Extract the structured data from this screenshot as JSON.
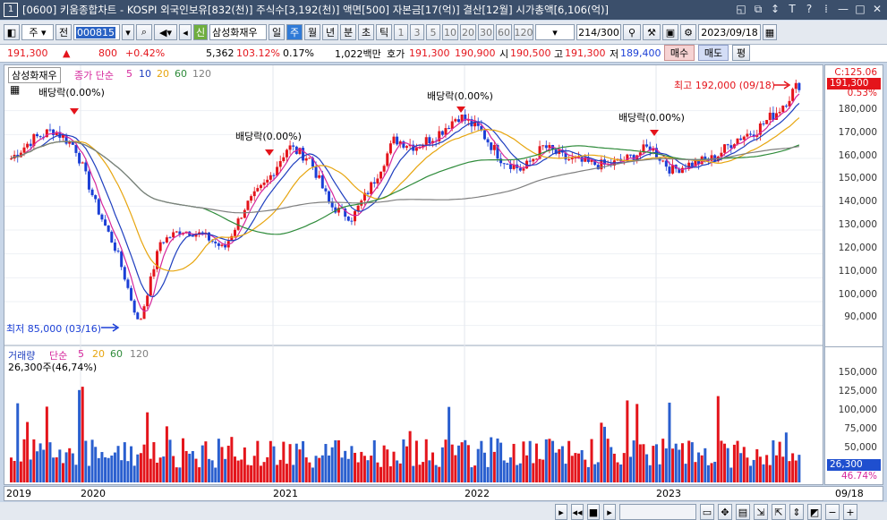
{
  "window": {
    "number": "1",
    "title": "[0600] 키움종합차트 - KOSPI 외국인보유[832(천)] 주식수[3,192(천)] 액면[500] 자본금[17(억)] 결산[12월] 시가총액[6,106(억)]",
    "buttons": [
      "◱",
      "⧉",
      "↕",
      "T",
      "?",
      "⁞",
      "—",
      "□",
      "✕"
    ]
  },
  "toolbar": {
    "period_type": "주",
    "scope": "전",
    "stock_code": "000815",
    "stock_name": "삼성화재우",
    "stock_badge": "신",
    "period_tabs": [
      "일",
      "주",
      "월",
      "년",
      "분",
      "초",
      "틱"
    ],
    "selected_period": "주",
    "intervals": [
      "1",
      "3",
      "5",
      "10",
      "20",
      "30",
      "60",
      "120"
    ],
    "count": "214",
    "count_total": "/300",
    "date": "2023/09/18"
  },
  "quote": {
    "price": "191,300",
    "arrow": "▲",
    "change": "800",
    "change_pct": "+0.42%",
    "volume": "5,362",
    "ratio": "103.12%",
    "rate": "0.17%",
    "amount": "1,022백만",
    "bid_label": "호가",
    "bid": "191,300",
    "ask": "190,900",
    "open_label": "시",
    "open": "190,500",
    "high_label": "고",
    "high": "191,300",
    "low_label": "저",
    "low": "189,400",
    "buy": "매수",
    "sell": "매도",
    "eval": "평"
  },
  "price_panel": {
    "name": "삼성화재우",
    "ma_label": "종가 단순",
    "ma_periods": [
      "5",
      "10",
      "20",
      "60",
      "120"
    ],
    "ma_colors": [
      "#d6279c",
      "#1f3fbf",
      "#e7a50e",
      "#2e8b3a",
      "#7f7f7f"
    ],
    "annotations": [
      "배당락(0.00%)",
      "배당락(0.00%)",
      "배당락(0.00%)",
      "배당락(0.00%)"
    ],
    "highest": "최고 192,000 (09/18)",
    "lowest": "최저 85,000 (03/16)"
  },
  "price_axis": {
    "top_label": "C:125.06",
    "current": "191,300",
    "pct": "0.53%",
    "ticks": [
      "180,000",
      "170,000",
      "160,000",
      "150,000",
      "140,000",
      "130,000",
      "120,000",
      "110,000",
      "100,000",
      "90,000"
    ]
  },
  "volume_panel": {
    "name": "거래량",
    "ma_label": "단순",
    "ma_periods": [
      "5",
      "20",
      "60",
      "120"
    ],
    "current": "26,300주(46,74%)",
    "current_tag": "26,300",
    "pct_tag": "46.74%",
    "ticks": [
      "150,000",
      "125,000",
      "100,000",
      "75,000",
      "50,000"
    ]
  },
  "x_axis": {
    "labels": [
      "2019",
      "2020",
      "2021",
      "2022",
      "2023"
    ],
    "end_label": "09/18"
  },
  "chart_data": {
    "type": "candlestick",
    "title": "삼성화재우 주봉",
    "ylim": [
      82000,
      196000
    ],
    "volume_ylim": [
      0,
      180000
    ],
    "x": [
      "2019-W01",
      "2020-W01",
      "2021-W01",
      "2022-W01",
      "2023-W01",
      "2023-W38"
    ],
    "close_path": [
      160000,
      168000,
      172000,
      165000,
      140000,
      120000,
      90000,
      125000,
      130000,
      128000,
      122000,
      140000,
      150000,
      165000,
      160000,
      140000,
      135000,
      150000,
      168000,
      165000,
      170000,
      178000,
      172000,
      160000,
      155000,
      165000,
      160000,
      158000,
      157000,
      160000,
      165000,
      155000,
      158000,
      160000,
      168000,
      172000,
      180000,
      191300
    ],
    "highest": 192000,
    "lowest": 85000
  }
}
